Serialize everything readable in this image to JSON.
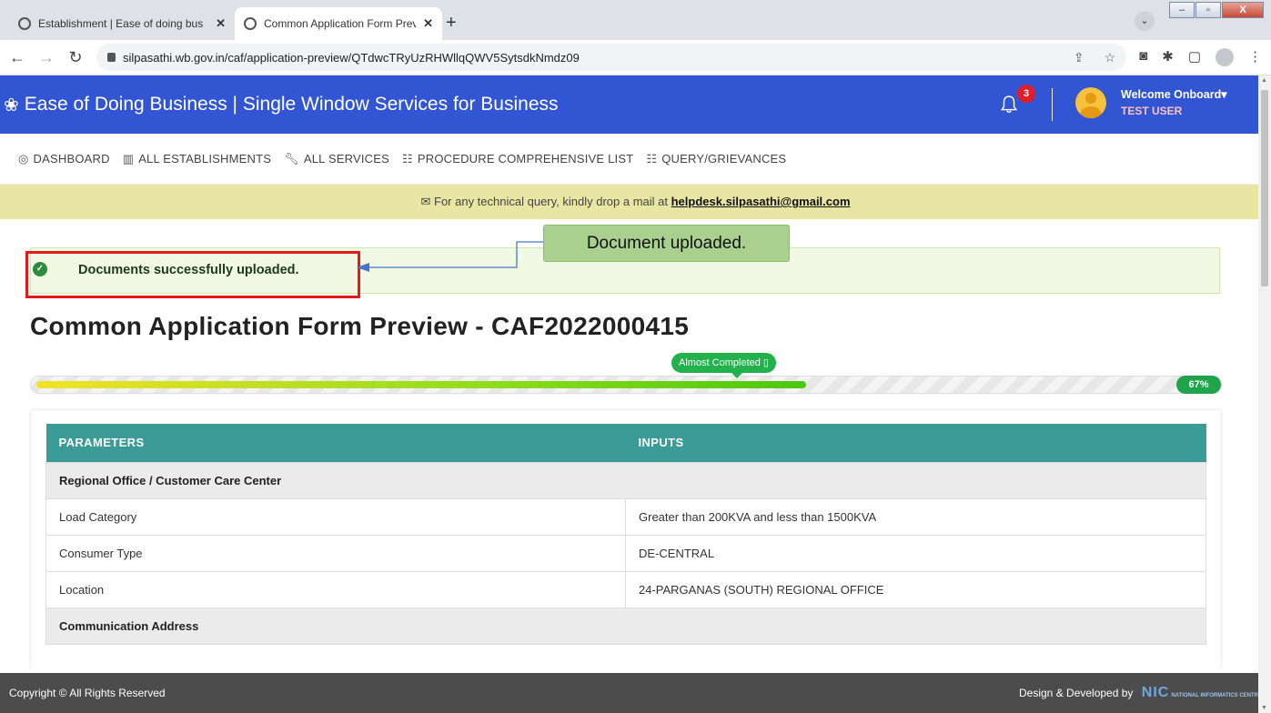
{
  "browser": {
    "tabs": [
      {
        "title": "Establishment | Ease of doing bus",
        "active": false
      },
      {
        "title": "Common Application Form Previ",
        "active": true
      }
    ],
    "new_tab": "+",
    "url": "silpasathi.wb.gov.in/caf/application-preview/QTdwcTRyUzRHWllqQWV5SytsdkNmdz09"
  },
  "header": {
    "brand": "Ease of Doing Business | Single Window Services for Business",
    "notification_count": "3",
    "welcome": "Welcome Onboard",
    "user": "TEST USER"
  },
  "nav": {
    "items": [
      {
        "label": "DASHBOARD",
        "icon": "dashboard-icon"
      },
      {
        "label": "ALL ESTABLISHMENTS",
        "icon": "building-icon"
      },
      {
        "label": "ALL SERVICES",
        "icon": "wrench-icon"
      },
      {
        "label": "PROCEDURE COMPREHENSIVE LIST",
        "icon": "list-icon"
      },
      {
        "label": "QUERY/GRIEVANCES",
        "icon": "list-icon"
      }
    ]
  },
  "notice": {
    "text": "For any technical query, kindly drop a mail at ",
    "email": "helpdesk.silpasathi@gmail.com"
  },
  "alert": {
    "message": "Documents successfully uploaded."
  },
  "callout": {
    "text": "Document uploaded."
  },
  "page": {
    "title": "Common Application Form Preview - CAF2022000415"
  },
  "progress": {
    "label": "Almost Completed",
    "percent_text": "67%",
    "fraction": 0.67
  },
  "table": {
    "headers": [
      "PARAMETERS",
      "INPUTS"
    ],
    "rows": [
      {
        "section": "Regional Office / Customer Care Center"
      },
      {
        "param": "Load Category",
        "input": "Greater than 200KVA and less than 1500KVA"
      },
      {
        "param": "Consumer Type",
        "input": "DE-CENTRAL"
      },
      {
        "param": "Location",
        "input": "24-PARGANAS (SOUTH) REGIONAL OFFICE"
      },
      {
        "section": "Communication Address"
      }
    ]
  },
  "footer": {
    "copyright": "Copyright © All Rights Reserved",
    "credit": "Design & Developed by",
    "nic": "NIC",
    "nic_small": "NATIONAL INFORMATICS CENTRE"
  },
  "colors": {
    "header_bg": "#3155d3",
    "table_header": "#3a9b97",
    "notice_bg": "#e9e6a3",
    "alert_border": "#e21b1b",
    "callout_bg": "#a9d08e"
  }
}
